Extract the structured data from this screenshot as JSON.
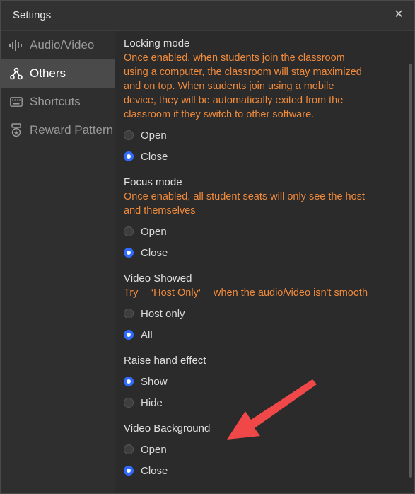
{
  "window": {
    "title": "Settings"
  },
  "sidebar": {
    "items": [
      {
        "label": "Audio/Video",
        "icon": "audio-wave-icon"
      },
      {
        "label": "Others",
        "icon": "network-icon",
        "active": true
      },
      {
        "label": "Shortcuts",
        "icon": "keyboard-icon"
      },
      {
        "label": "Reward Pattern",
        "icon": "medal-icon"
      }
    ]
  },
  "sections": {
    "locking": {
      "title": "Locking mode",
      "desc": [
        "Once enabled, when students join the classroom",
        "using a computer, the classroom will stay maximized",
        "and on top. When students join using a mobile",
        "device, they will be automatically exited from the",
        "classroom if they switch to other software."
      ],
      "options": [
        "Open",
        "Close"
      ],
      "selected": "Close"
    },
    "focus": {
      "title": "Focus mode",
      "desc": [
        "Once enabled, all student seats will only see the host",
        "and themselves"
      ],
      "options": [
        "Open",
        "Close"
      ],
      "selected": "Close"
    },
    "video_showed": {
      "title": "Video Showed",
      "desc": "Try 　‘Host Only’　 when the audio/video isn't smooth",
      "options": [
        "Host only",
        "All"
      ],
      "selected": "All"
    },
    "raise_hand": {
      "title": "Raise hand effect",
      "options": [
        "Show",
        "Hide"
      ],
      "selected": "Show"
    },
    "video_background": {
      "title": "Video Background",
      "options": [
        "Open",
        "Close"
      ],
      "selected": "Close"
    }
  },
  "colors": {
    "accent": "#2f6bff",
    "warning_text": "#f08a3c",
    "annotation_arrow": "#f04848"
  }
}
